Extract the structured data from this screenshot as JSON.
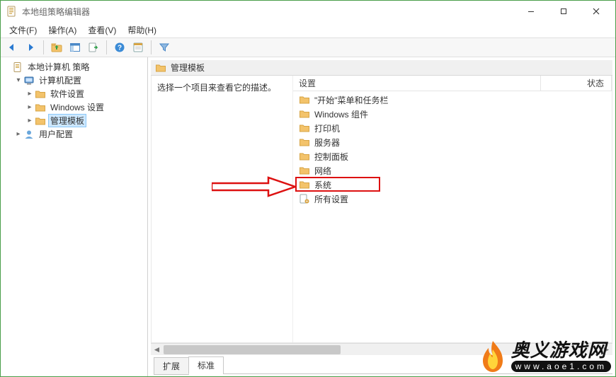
{
  "window": {
    "title": "本地组策略编辑器"
  },
  "menus": {
    "file": "文件(F)",
    "action": "操作(A)",
    "view": "查看(V)",
    "help": "帮助(H)"
  },
  "tree": {
    "root": "本地计算机 策略",
    "computer_config": "计算机配置",
    "software_settings": "软件设置",
    "windows_settings": "Windows 设置",
    "admin_templates": "管理模板",
    "user_config": "用户配置"
  },
  "detail": {
    "header": "管理模板",
    "description": "选择一个项目来查看它的描述。",
    "col_name": "设置",
    "col_state": "状态",
    "items": [
      "\"开始\"菜单和任务栏",
      "Windows 组件",
      "打印机",
      "服务器",
      "控制面板",
      "网络",
      "系统",
      "所有设置"
    ]
  },
  "tabs": {
    "extended": "扩展",
    "standard": "标准"
  },
  "watermark": {
    "cn": "奥义游戏网",
    "url": "www.aoe1.com"
  },
  "colors": {
    "accent": "#4a9e4a",
    "selection": "#cde8ff",
    "highlight": "#d11",
    "folder": "#f3c36b",
    "folder_dark": "#d7a445"
  }
}
